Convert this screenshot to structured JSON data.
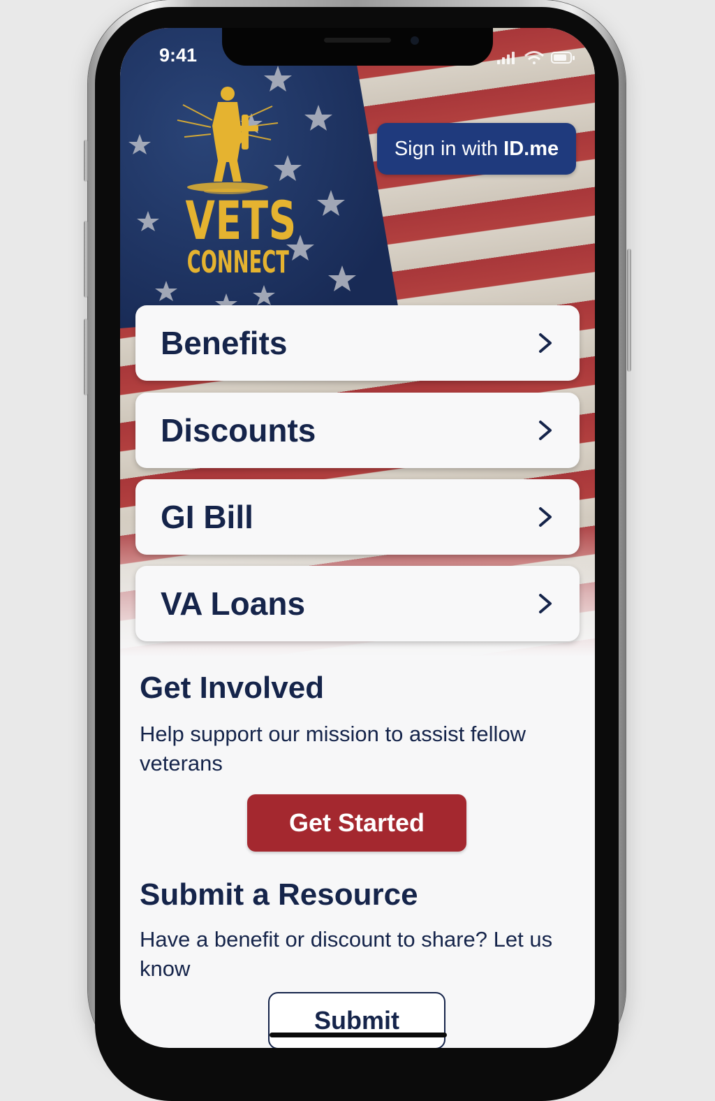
{
  "status_bar": {
    "time": "9:41"
  },
  "header": {
    "logo_line1": "VETS",
    "logo_line2": "CONNECT",
    "signin_prefix": "Sign in with",
    "signin_brand": "ID.me"
  },
  "menu": {
    "items": [
      {
        "label": "Benefits",
        "icon": "chevron-right-icon"
      },
      {
        "label": "Discounts",
        "icon": "chevron-right-icon"
      },
      {
        "label": "GI Bill",
        "icon": "chevron-right-icon"
      },
      {
        "label": "VA Loans",
        "icon": "chevron-right-icon"
      }
    ]
  },
  "get_involved": {
    "title": "Get Involved",
    "description": "Help support our mission to assist fellow veterans",
    "button_label": "Get Started"
  },
  "submit_resource": {
    "title": "Submit a Resource",
    "description": "Have a benefit or discount to share? Let us know",
    "button_label": "Submit"
  },
  "colors": {
    "navy": "#15244a",
    "accent_red": "#a4282f",
    "signin_blue": "#1f3a7d",
    "logo_gold": "#e5b330"
  }
}
